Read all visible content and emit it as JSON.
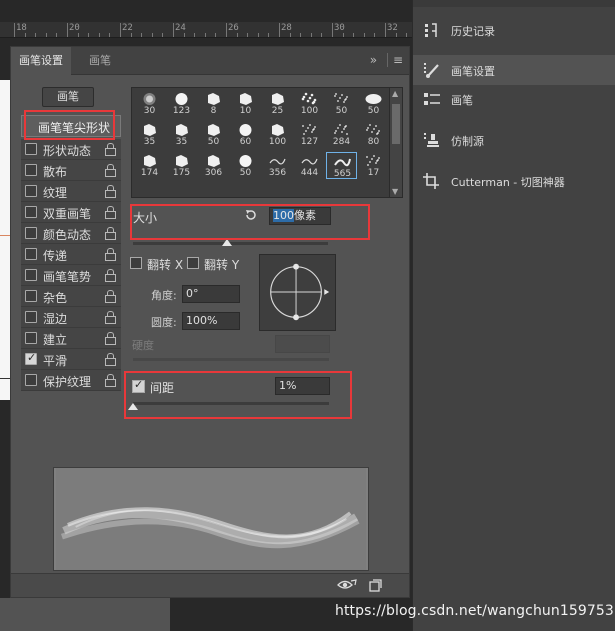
{
  "ruler": {
    "numbers": [
      "18",
      "20",
      "22",
      "24",
      "26",
      "28",
      "30",
      "32",
      "34"
    ]
  },
  "brush_panel": {
    "tabs": [
      {
        "label": "画笔设置"
      },
      {
        "label": "画笔"
      }
    ],
    "menu_glyphs": {
      "collapse": "»",
      "menu": "≡"
    },
    "brush_button": "画笔",
    "options": [
      {
        "label": "画笔笔尖形状",
        "checkbox": false,
        "checked": false,
        "lock": false,
        "selected": true
      },
      {
        "label": "形状动态",
        "checkbox": true,
        "checked": false,
        "lock": true
      },
      {
        "label": "散布",
        "checkbox": true,
        "checked": false,
        "lock": true
      },
      {
        "label": "纹理",
        "checkbox": true,
        "checked": false,
        "lock": true
      },
      {
        "label": "双重画笔",
        "checkbox": true,
        "checked": false,
        "lock": true
      },
      {
        "label": "颜色动态",
        "checkbox": true,
        "checked": false,
        "lock": true
      },
      {
        "label": "传递",
        "checkbox": true,
        "checked": false,
        "lock": true
      },
      {
        "label": "画笔笔势",
        "checkbox": true,
        "checked": false,
        "lock": true
      },
      {
        "label": "杂色",
        "checkbox": true,
        "checked": false,
        "lock": true
      },
      {
        "label": "湿边",
        "checkbox": true,
        "checked": false,
        "lock": true
      },
      {
        "label": "建立",
        "checkbox": true,
        "checked": false,
        "lock": true
      },
      {
        "label": "平滑",
        "checkbox": true,
        "checked": true,
        "lock": true
      },
      {
        "label": "保护纹理",
        "checkbox": true,
        "checked": false,
        "lock": true
      }
    ],
    "presets": [
      "30",
      "123",
      "8",
      "10",
      "25",
      "100",
      "50",
      "50",
      "35",
      "35",
      "50",
      "60",
      "100",
      "127",
      "284",
      "80",
      "174",
      "175",
      "306",
      "50",
      "356",
      "444",
      "565",
      "17"
    ],
    "selected_preset": "565",
    "size": {
      "label": "大小",
      "value": "100",
      "unit": "像素",
      "fraction": 0.48
    },
    "flip_x": {
      "label": "翻转 X",
      "checked": false
    },
    "flip_y": {
      "label": "翻转 Y",
      "checked": false
    },
    "angle": {
      "label": "角度:",
      "value": "0°"
    },
    "roundness": {
      "label": "圆度:",
      "value": "100%"
    },
    "hardness": {
      "label": "硬度",
      "value": ""
    },
    "spacing": {
      "label": "间距",
      "value": "1%",
      "checked": true,
      "fraction": 0.0
    }
  },
  "side_panel": {
    "items": [
      {
        "label": "历史记录",
        "icon": "history-icon",
        "active": false
      },
      {
        "label": "画笔设置",
        "icon": "brush-settings-icon",
        "active": true
      },
      {
        "label": "画笔",
        "icon": "brush-icon",
        "active": false
      },
      {
        "label": "仿制源",
        "icon": "clone-source-icon",
        "active": false
      },
      {
        "label": "Cutterman - 切图神器",
        "icon": "crop-icon",
        "active": false
      }
    ]
  },
  "watermark": "https://blog.csdn.net/wangchun159753",
  "colors": {
    "highlight": "#e8383a",
    "panel": "#535353",
    "selected_cell": "#6fb2e8"
  }
}
